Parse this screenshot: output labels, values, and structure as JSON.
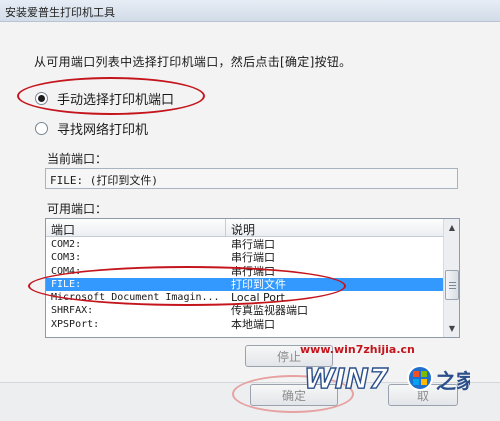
{
  "window": {
    "title": "安装爱普生打印机工具"
  },
  "instruction": "从可用端口列表中选择打印机端口，然后点击[确定]按钮。",
  "options": {
    "manual": {
      "label": "手动选择打印机端口",
      "checked": true
    },
    "network": {
      "label": "寻找网络打印机",
      "checked": false
    }
  },
  "current_port": {
    "label": "当前端口：",
    "value": "FILE: (打印到文件)"
  },
  "available_ports": {
    "label": "可用端口：",
    "columns": [
      "端口",
      "说明"
    ],
    "rows": [
      {
        "port": "COM2:",
        "desc": "串行端口",
        "selected": false
      },
      {
        "port": "COM3:",
        "desc": "串行端口",
        "selected": false
      },
      {
        "port": "COM4:",
        "desc": "串行端口",
        "selected": false
      },
      {
        "port": "FILE:",
        "desc": "打印到文件",
        "selected": true
      },
      {
        "port": "Microsoft Document Imagin...",
        "desc": "Local Port",
        "selected": false
      },
      {
        "port": "SHRFAX:",
        "desc": "传真监视器端口",
        "selected": false
      },
      {
        "port": "XPSPort:",
        "desc": "本地端口",
        "selected": false
      }
    ]
  },
  "buttons": {
    "stop": "停止",
    "ok": "确定",
    "cancel": "取"
  },
  "watermark": {
    "url": "www.win7zhijia.cn",
    "logo_text": "WIN7",
    "logo_suffix": "之家"
  },
  "colors": {
    "selection": "#3399ff",
    "annotation_red": "#c4151c"
  }
}
